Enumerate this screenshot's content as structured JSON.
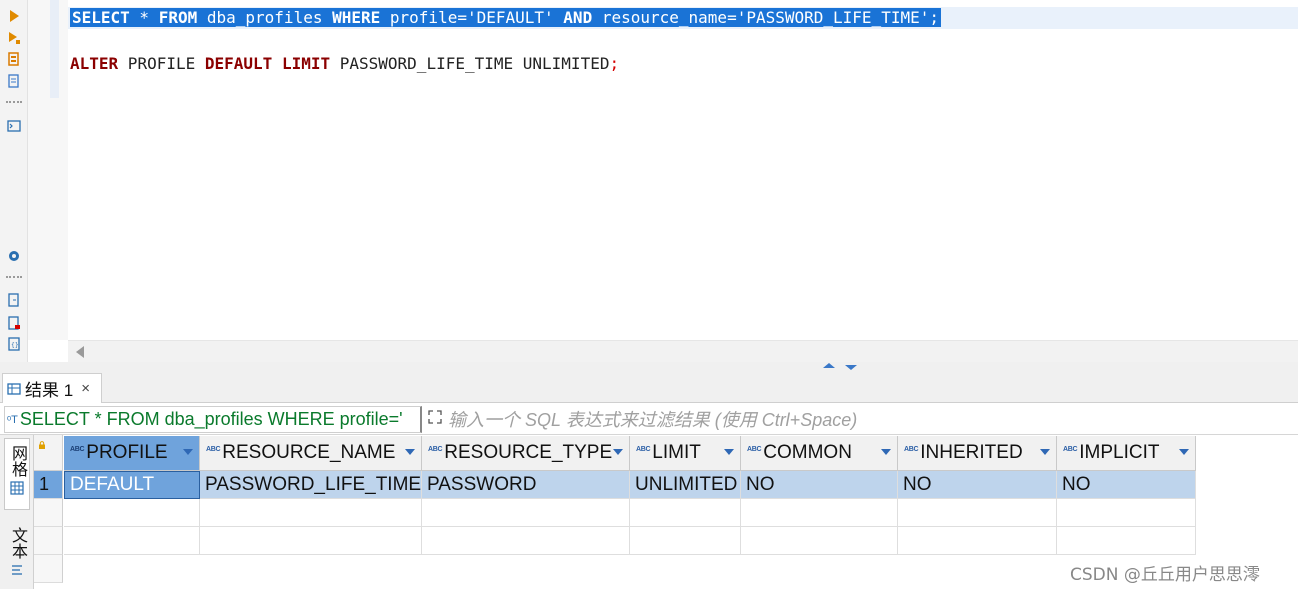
{
  "toolbar": {
    "icons": [
      "run-statement-icon",
      "run-script-icon",
      "explain-plan-icon",
      "load-script-icon",
      "terminal-icon",
      "settings-icon",
      "export-icon",
      "new-script-icon",
      "format-icon"
    ]
  },
  "editor": {
    "line1": {
      "kw_select": "SELECT",
      "star": " * ",
      "kw_from": "FROM",
      "table": " dba_profiles ",
      "kw_where": "WHERE",
      "cond1": " profile='DEFAULT' ",
      "kw_and": "AND",
      "cond2": " resource_name='PASSWORD_LIFE_TIME';"
    },
    "line2": {
      "kw_alter": "ALTER",
      "profile_word": " PROFILE ",
      "kw_default": "DEFAULT",
      "kw_limit": " LIMIT",
      "rest": " PASSWORD_LIFE_TIME UNLIMITED",
      "semicolon": ";"
    }
  },
  "results_tab": {
    "label": "结果 1",
    "close": "×"
  },
  "filter": {
    "query_text": "SELECT * FROM dba_profiles WHERE profile='",
    "placeholder": "输入一个 SQL 表达式来过滤结果 (使用 Ctrl+Space)"
  },
  "side_tabs": {
    "grid_label": "网格",
    "text_label": "文本"
  },
  "grid": {
    "type_badge": "ABC",
    "columns": [
      "PROFILE",
      "RESOURCE_NAME",
      "RESOURCE_TYPE",
      "LIMIT",
      "COMMON",
      "INHERITED",
      "IMPLICIT"
    ],
    "rows": [
      {
        "num": "1",
        "cells": [
          "DEFAULT",
          "PASSWORD_LIFE_TIME",
          "PASSWORD",
          "UNLIMITED",
          "NO",
          "NO",
          "NO"
        ]
      }
    ]
  },
  "watermark": "CSDN @丘丘用户思思澪",
  "colors": {
    "selection": "#1a73d6",
    "keyword_red": "#8b0000",
    "filter_green": "#0a7a2c",
    "selected_row": "#bed4ec",
    "active_header": "#6fa3dc"
  }
}
